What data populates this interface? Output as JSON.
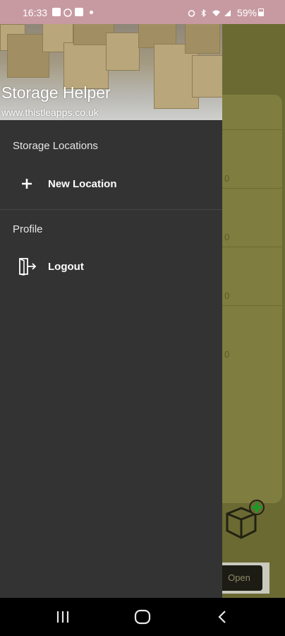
{
  "status_bar": {
    "time": "16:33",
    "battery": "59%",
    "icons_left": [
      "gallery-icon",
      "whatsapp-icon",
      "notification-icon"
    ],
    "icons_right": [
      "alarm-icon",
      "bluetooth-icon",
      "wifi-icon",
      "signal-icon"
    ]
  },
  "drawer": {
    "title": "Storage Helper",
    "subtitle": "www.thistleapps.co.uk",
    "sections": [
      {
        "label": "Storage Locations",
        "items": [
          {
            "label": "New Location",
            "icon": "plus-icon"
          }
        ]
      },
      {
        "label": "Profile",
        "items": [
          {
            "label": "Logout",
            "icon": "logout-icon"
          }
        ]
      }
    ]
  },
  "background": {
    "open_button": "Open",
    "row_digits": [
      "0",
      "0",
      "0",
      "0"
    ]
  },
  "colors": {
    "drawer_bg": "#333333",
    "status_bar": "#c79aa2",
    "scrim": "#6b6a33",
    "add_green": "#1a9a2a"
  }
}
